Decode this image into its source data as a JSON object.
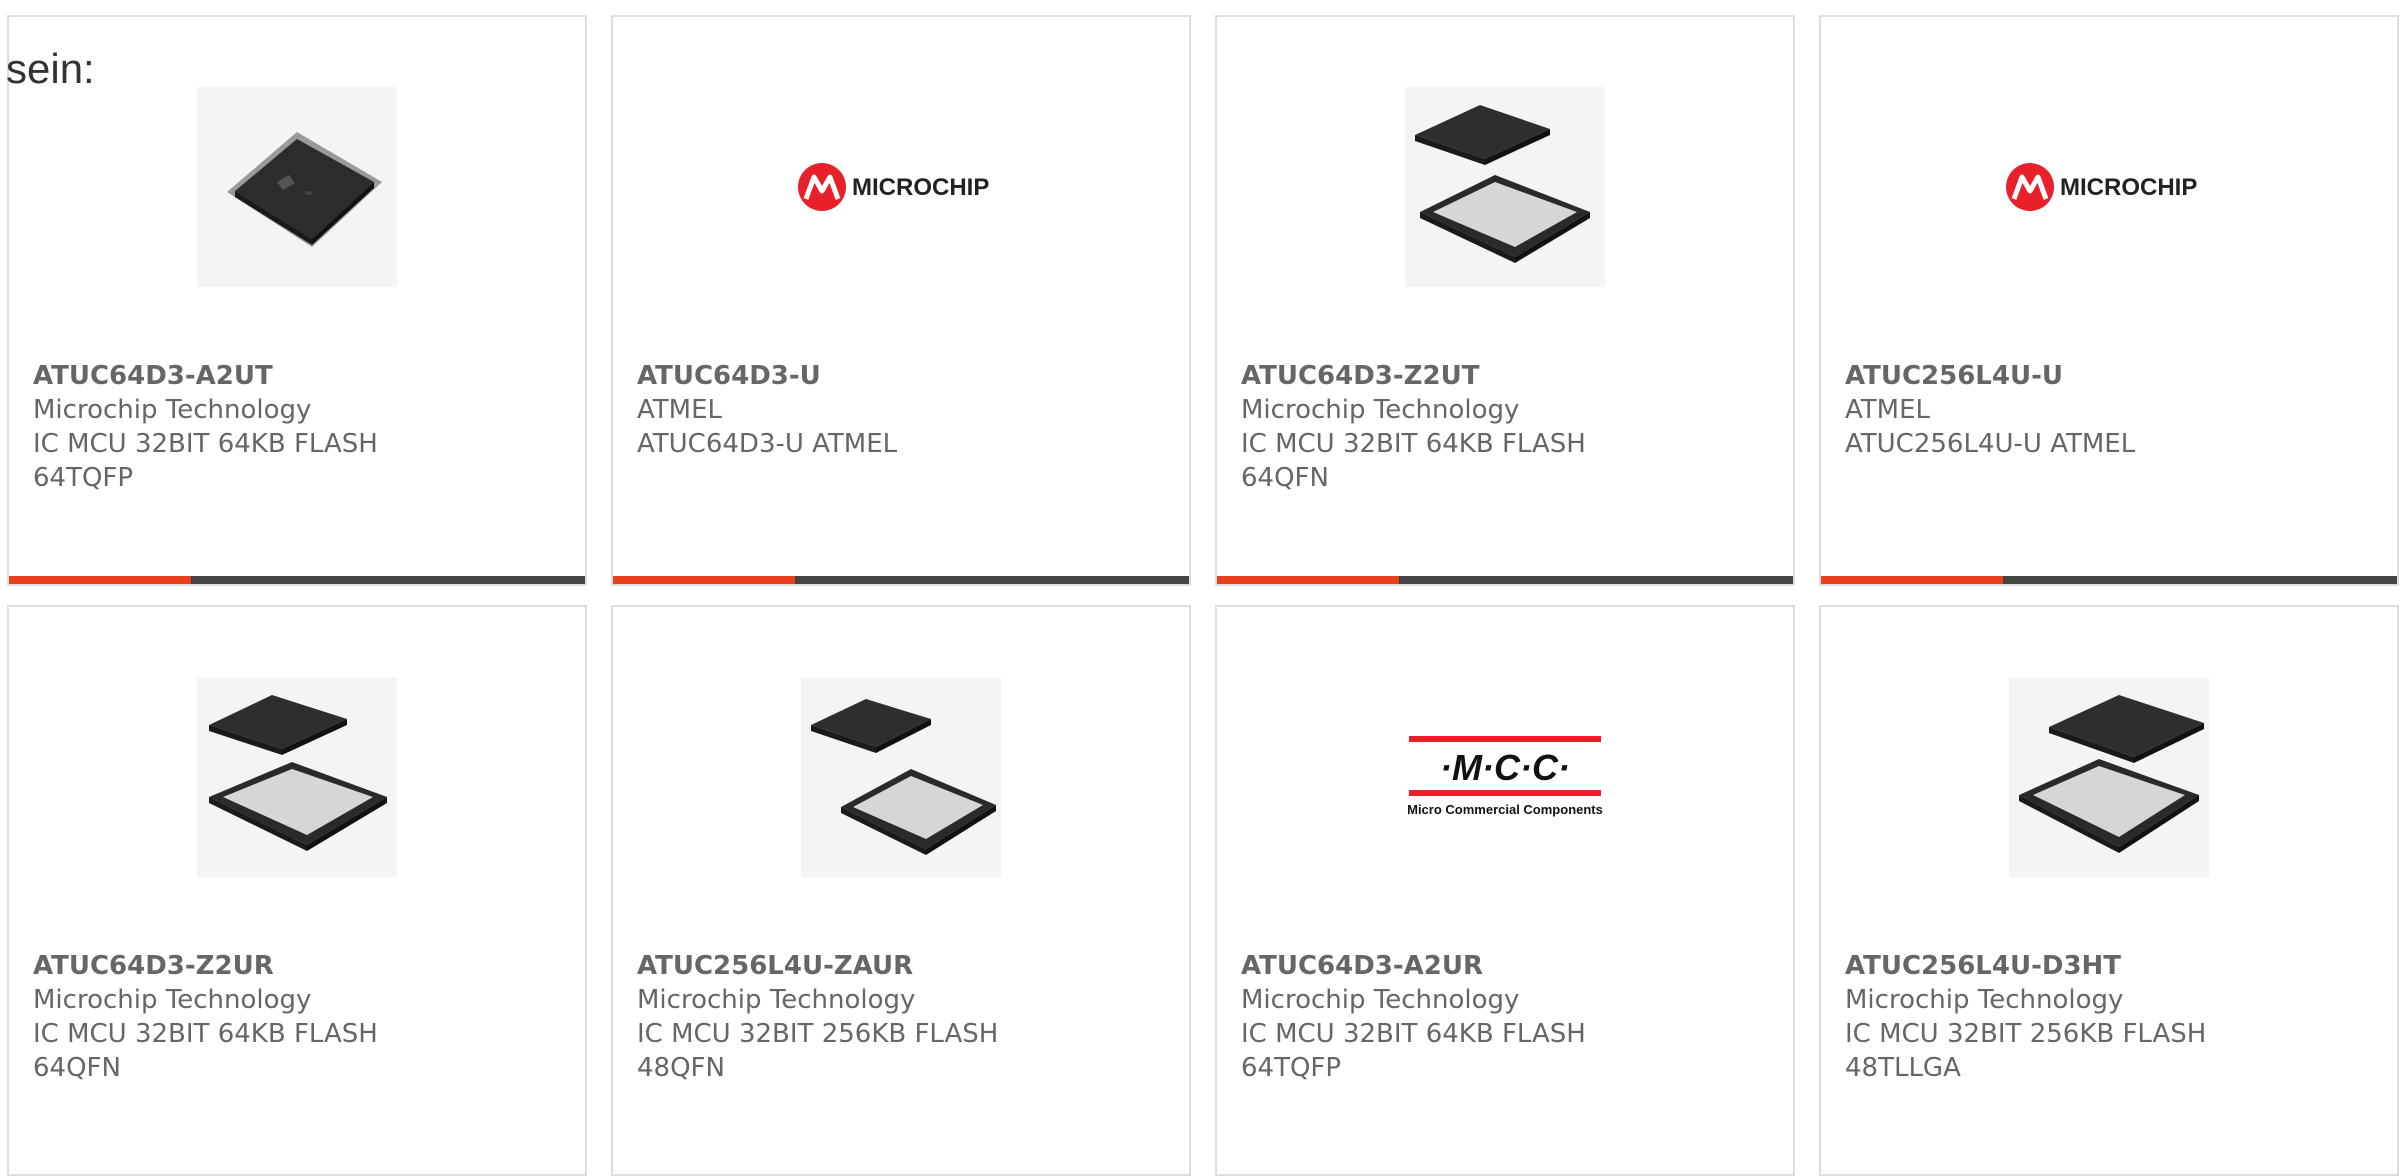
{
  "intro_text": "sein:",
  "accent_color": "#e8401c",
  "bar_color": "#444444",
  "products": [
    {
      "part": "ATUC64D3-A2UT",
      "maker": "Microchip Technology",
      "desc1": "IC MCU 32BIT 64KB FLASH",
      "desc2": "64TQFP",
      "image": "tqfp-chip-photo"
    },
    {
      "part": "ATUC64D3-U",
      "maker": "ATMEL",
      "desc1": "ATUC64D3-U ATMEL",
      "desc2": "",
      "image": "microchip-logo",
      "logo_text": "MICROCHIP"
    },
    {
      "part": "ATUC64D3-Z2UT",
      "maker": "Microchip Technology",
      "desc1": "IC MCU 32BIT 64KB FLASH",
      "desc2": "64QFN",
      "image": "qfn-chip-photo"
    },
    {
      "part": "ATUC256L4U-U",
      "maker": "ATMEL",
      "desc1": "ATUC256L4U-U ATMEL",
      "desc2": "",
      "image": "microchip-logo",
      "logo_text": "MICROCHIP"
    },
    {
      "part": "ATUC64D3-Z2UR",
      "maker": "Microchip Technology",
      "desc1": "IC MCU 32BIT 64KB FLASH",
      "desc2": "64QFN",
      "image": "qfn-chip-photo"
    },
    {
      "part": "ATUC256L4U-ZAUR",
      "maker": "Microchip Technology",
      "desc1": "IC MCU 32BIT 256KB FLASH",
      "desc2": "48QFN",
      "image": "qfn-chip-photo"
    },
    {
      "part": "ATUC64D3-A2UR",
      "maker": "Microchip Technology",
      "desc1": "IC MCU 32BIT 64KB FLASH",
      "desc2": "64TQFP",
      "image": "mcc-logo",
      "logo_text": "·M·C·C·",
      "logo_sub": "Micro Commercial Components"
    },
    {
      "part": "ATUC256L4U-D3HT",
      "maker": "Microchip Technology",
      "desc1": "IC MCU 32BIT 256KB FLASH",
      "desc2": "48TLLGA",
      "image": "qfn-chip-photo"
    }
  ]
}
